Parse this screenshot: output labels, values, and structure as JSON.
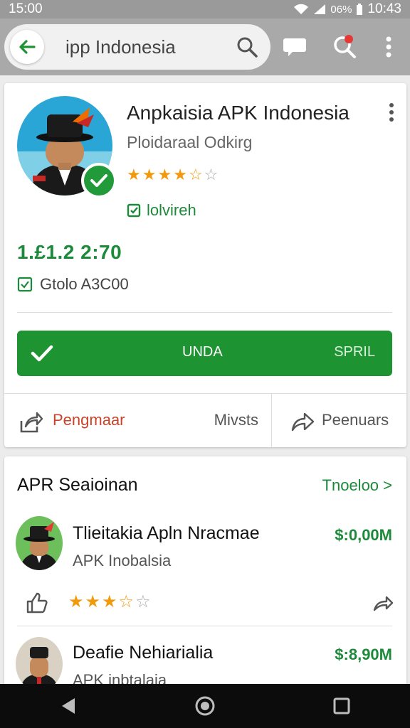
{
  "status_bar": {
    "time_left": "15:00",
    "battery": "06%",
    "time_right": "10:43"
  },
  "search": {
    "query": "ipp Indonesia"
  },
  "app": {
    "title": "Anpkaisia APK Indonesia",
    "developer": "Ploidaraal Odkirg",
    "rating": 4.5,
    "status_label": "lolvireh",
    "version": "1.£1.2 2:70",
    "size_label": "Gtolo A3C00",
    "install_label": "UNDA",
    "install_sub_label": "SPRIL",
    "share_label": "Pengmaar",
    "minus_label": "Mivsts",
    "forward_label": "Peenuars"
  },
  "similar": {
    "title": "APR Seaioinan",
    "see_more": "Tnoeloo >",
    "items": [
      {
        "name": "Tlieitakia Apln Nracmae",
        "sub": "APK Inobalsia",
        "price": "$:0,00M",
        "rating": 3.5
      },
      {
        "name": "Deafie Nehiarialia",
        "sub": "APK inbtalaia",
        "price": "$:8,90M"
      }
    ]
  },
  "colors": {
    "accent_green": "#1e9332",
    "star": "#f29a0e",
    "share_red": "#c7442b"
  }
}
